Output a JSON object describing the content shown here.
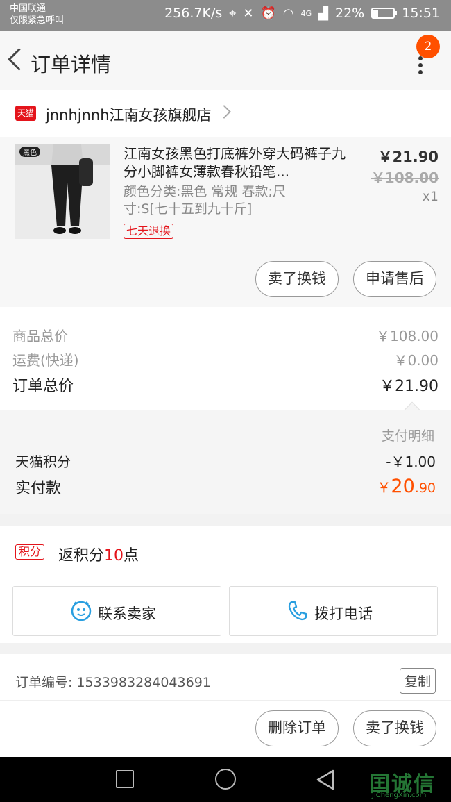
{
  "status_bar": {
    "carrier_line1": "中国联通",
    "carrier_line2": "仅限紧急呼叫",
    "speed": "256.7K/s",
    "network": "4G",
    "battery": "22%",
    "battery_level": 0.22,
    "time": "15:51"
  },
  "header": {
    "title": "订单详情",
    "badge_count": "2"
  },
  "shop": {
    "logo_text": "天猫",
    "name": "jnnhjnnh江南女孩旗舰店"
  },
  "product": {
    "thumb_tag": "黑色",
    "name": "江南女孩黑色打底裤外穿大码裤子九分小脚裤女薄款春秋铅笔...",
    "sku": "颜色分类:黑色 常规 春款;尺寸:S[七十五到九十斤]",
    "return_tag": "七天退换",
    "price": "￥21.90",
    "original_price": "￥108.00",
    "quantity": "x1",
    "actions": [
      "卖了换钱",
      "申请售后"
    ]
  },
  "summary": {
    "goods_total_label": "商品总价",
    "goods_total_value": "￥108.00",
    "shipping_label": "运费(快递)",
    "shipping_value": "￥0.00",
    "order_total_label": "订单总价",
    "order_total_value": "￥21.90"
  },
  "payment": {
    "detail_label": "支付明细",
    "points_label": "天猫积分",
    "points_value": "-￥1.00",
    "paid_label": "实付款",
    "paid_currency": "￥",
    "paid_int": "20",
    "paid_dec": ".90"
  },
  "points": {
    "tag": "积分",
    "text_prefix": "返积分",
    "number": "10",
    "text_suffix": "点"
  },
  "contact": {
    "seller_label": "联系卖家",
    "phone_label": "拨打电话"
  },
  "order": {
    "number_label": "订单编号:",
    "number": "1533983284043691",
    "copy_label": "复制"
  },
  "bottom_actions": [
    "删除订单",
    "卖了换钱"
  ],
  "watermark": {
    "text": "诚信",
    "sub": "JiChengXin.com"
  },
  "colors": {
    "accent": "#ff5000",
    "tmall_red": "#e4141b",
    "contact_blue": "#2a9fe0"
  }
}
